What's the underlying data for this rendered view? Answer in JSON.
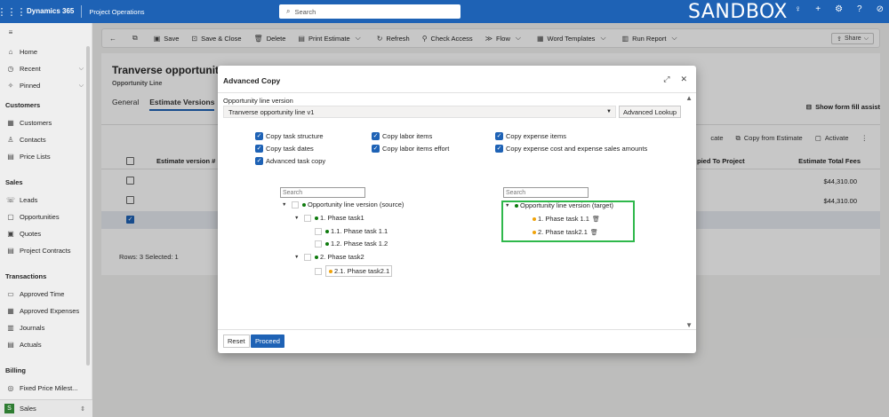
{
  "topbar": {
    "app_name": "Dynamics 365",
    "area": "Project Operations",
    "search_placeholder": "Search",
    "environment": "SANDBOX",
    "brand_color": "#1e62b5"
  },
  "sidebar": {
    "items_top": [
      {
        "label": "Home",
        "icon": "home-icon"
      },
      {
        "label": "Recent",
        "icon": "clock-icon"
      },
      {
        "label": "Pinned",
        "icon": "pin-icon"
      }
    ],
    "sections": [
      {
        "title": "Customers",
        "items": [
          "Customers",
          "Contacts",
          "Price Lists"
        ]
      },
      {
        "title": "Sales",
        "items": [
          "Leads",
          "Opportunities",
          "Quotes",
          "Project Contracts"
        ]
      },
      {
        "title": "Transactions",
        "items": [
          "Approved Time",
          "Approved Expenses",
          "Journals",
          "Actuals"
        ]
      },
      {
        "title": "Billing",
        "items": [
          "Fixed Price Milest..."
        ]
      }
    ],
    "footer": {
      "badge": "S",
      "label": "Sales"
    }
  },
  "commandbar": {
    "save": "Save",
    "save_close": "Save & Close",
    "delete": "Delete",
    "print_estimate": "Print Estimate",
    "refresh": "Refresh",
    "check_access": "Check Access",
    "flow": "Flow",
    "word_templates": "Word Templates",
    "run_report": "Run Report",
    "share": "Share"
  },
  "form": {
    "title": "Tranverse opportunity li",
    "subtitle": "Opportunity Line",
    "tabs": [
      "General",
      "Estimate Versions"
    ],
    "show_assist": "Show form fill assist",
    "grid": {
      "commands": [
        "cate",
        "Copy from Estimate",
        "Activate"
      ],
      "headers": {
        "version": "Estimate version #",
        "copied": "pied To Project",
        "fees": "Estimate Total Fees"
      },
      "rows": [
        {
          "amount": "$44,310.00",
          "selected": false
        },
        {
          "amount": "$44,310.00",
          "selected": false
        },
        {
          "amount": "",
          "selected": true
        }
      ],
      "rows_info": "Rows: 3    Selected: 1"
    }
  },
  "dialog": {
    "title": "Advanced Copy",
    "version_label": "Opportunity line version",
    "version_value": "Tranverse opportunity line v1",
    "advanced_lookup": "Advanced Lookup",
    "options": {
      "copy_task_structure": "Copy task structure",
      "copy_task_dates": "Copy task dates",
      "advanced_task_copy": "Advanced task copy",
      "copy_labor_items": "Copy labor items",
      "copy_labor_effort": "Copy labor items effort",
      "copy_expense_items": "Copy expense items",
      "copy_expense_amounts": "Copy expense cost and expense sales amounts"
    },
    "source_tree": {
      "search_placeholder": "Search",
      "root": "Opportunity line version (source)",
      "task1": "1. Phase task1",
      "task1_1": "1.1. Phase task 1.1",
      "task1_2": "1.2. Phase task 1.2",
      "task2": "2. Phase task2",
      "task2_1": "2.1. Phase task2.1"
    },
    "target_tree": {
      "search_placeholder": "Search",
      "root": "Opportunity line version (target)",
      "task1_1": "1. Phase task 1.1",
      "task2_1": "2. Phase task2.1"
    },
    "reset": "Reset",
    "proceed": "Proceed",
    "highlight_color": "#2fb84b"
  }
}
